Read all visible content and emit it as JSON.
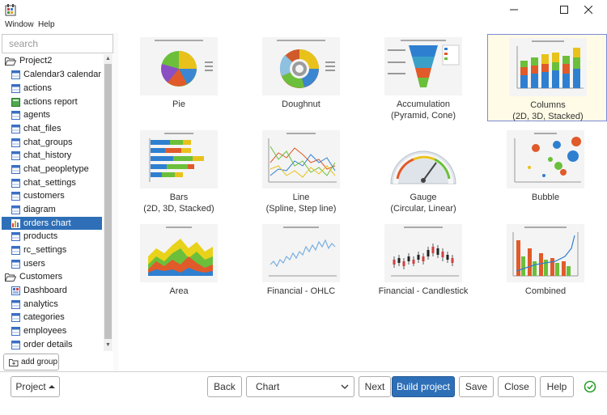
{
  "window": {
    "title": "",
    "minimize_icon": "minimize-icon",
    "maximize_icon": "maximize-icon",
    "close_icon": "close-icon"
  },
  "menu": {
    "items": [
      "Window",
      "Help"
    ]
  },
  "sidebar": {
    "search_placeholder": "search",
    "tree": [
      {
        "label": "Project2",
        "icon": "folder-open-icon",
        "level": 0
      },
      {
        "label": "Calendar3 calendar",
        "icon": "table-icon",
        "level": 1
      },
      {
        "label": "actions",
        "icon": "table-icon",
        "level": 1
      },
      {
        "label": "actions report",
        "icon": "report-icon",
        "level": 1
      },
      {
        "label": "agents",
        "icon": "table-icon",
        "level": 1
      },
      {
        "label": "chat_files",
        "icon": "table-icon",
        "level": 1
      },
      {
        "label": "chat_groups",
        "icon": "table-icon",
        "level": 1
      },
      {
        "label": "chat_history",
        "icon": "table-icon",
        "level": 1
      },
      {
        "label": "chat_peopletype",
        "icon": "table-icon",
        "level": 1
      },
      {
        "label": "chat_settings",
        "icon": "table-icon",
        "level": 1
      },
      {
        "label": "customers",
        "icon": "table-icon",
        "level": 1
      },
      {
        "label": "diagram",
        "icon": "table-icon",
        "level": 1
      },
      {
        "label": "orders chart",
        "icon": "chart-icon",
        "level": 1,
        "selected": true
      },
      {
        "label": "products",
        "icon": "table-icon",
        "level": 1
      },
      {
        "label": "rc_settings",
        "icon": "table-icon",
        "level": 1
      },
      {
        "label": "users",
        "icon": "table-icon",
        "level": 1
      },
      {
        "label": "Customers",
        "icon": "folder-open-icon",
        "level": 0
      },
      {
        "label": "Dashboard",
        "icon": "dashboard-icon",
        "level": 1
      },
      {
        "label": "analytics",
        "icon": "table-icon",
        "level": 1
      },
      {
        "label": "categories",
        "icon": "table-icon",
        "level": 1
      },
      {
        "label": "employees",
        "icon": "table-icon",
        "level": 1
      },
      {
        "label": "order details",
        "icon": "table-icon",
        "level": 1
      }
    ],
    "add_group_label": "add group"
  },
  "chart_types": [
    {
      "name": "pie",
      "line1": "Pie",
      "line2": ""
    },
    {
      "name": "doughnut",
      "line1": "Doughnut",
      "line2": ""
    },
    {
      "name": "accumulation",
      "line1": "Accumulation",
      "line2": "(Pyramid, Cone)"
    },
    {
      "name": "columns",
      "line1": "Columns",
      "line2": "(2D, 3D, Stacked)",
      "selected": true
    },
    {
      "name": "bars",
      "line1": "Bars",
      "line2": "(2D, 3D, Stacked)"
    },
    {
      "name": "line",
      "line1": "Line",
      "line2": "(Spline, Step line)"
    },
    {
      "name": "gauge",
      "line1": "Gauge",
      "line2": "(Circular, Linear)"
    },
    {
      "name": "bubble",
      "line1": "Bubble",
      "line2": ""
    },
    {
      "name": "area",
      "line1": "Area",
      "line2": ""
    },
    {
      "name": "financial-ohlc",
      "line1": "Financial - OHLC",
      "line2": ""
    },
    {
      "name": "financial-candlestick",
      "line1": "Financial - Candlestick",
      "line2": ""
    },
    {
      "name": "combined",
      "line1": "Combined",
      "line2": ""
    }
  ],
  "bottom": {
    "project_label": "Project",
    "back_label": "Back",
    "select_value": "Chart",
    "next_label": "Next",
    "build_label": "Build project",
    "save_label": "Save",
    "close_label": "Close",
    "help_label": "Help"
  },
  "colors": {
    "accent": "#2e6fb7",
    "selected_tile_bg": "#fffbe6",
    "selected_tile_border": "#7b8bd6",
    "success": "#2a9d2a"
  }
}
